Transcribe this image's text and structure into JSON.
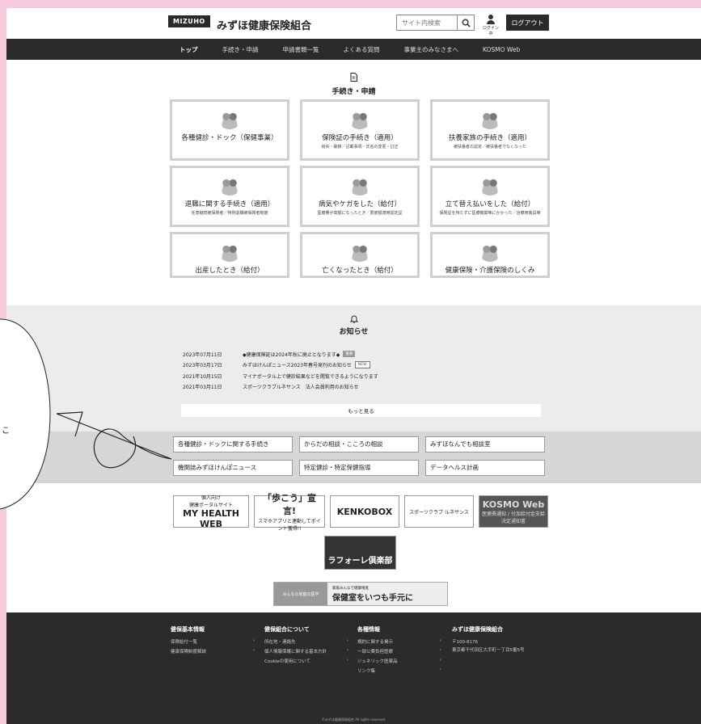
{
  "header": {
    "logo": "MIZUHO",
    "org_name": "みずほ健康保険組合",
    "search_placeholder": "サイト内検索",
    "login_status": "ログイン中",
    "logout_label": "ログアウト"
  },
  "nav": [
    "トップ",
    "手続き・申請",
    "申請書類一覧",
    "よくある質問",
    "事業主のみなさまへ",
    "KOSMO Web"
  ],
  "procedures": {
    "icon": "document-icon",
    "title": "手続き・申請",
    "cards": [
      {
        "title": "各種健診・ドック（保健事業）",
        "sub": ""
      },
      {
        "title": "保険証の手続き（適用）",
        "sub": "紛失・破損／記載事項・氏名の変更・訂正"
      },
      {
        "title": "扶養家族の手続き（適用）",
        "sub": "被扶養者の認定／被扶養者でなくなった"
      },
      {
        "title": "退職に関する手続き（適用）",
        "sub": "任意継続被保険者／特例退職被保険者制度"
      },
      {
        "title": "病気やケガをした（給付）",
        "sub": "医療費が高額になったとき／限度額適用認定証"
      },
      {
        "title": "立て替え払いをした（給付）",
        "sub": "保険証を持たずに医療機関等にかかった／治療用装具等"
      },
      {
        "title": "出産したとき（給付）",
        "sub": ""
      },
      {
        "title": "亡くなったとき（給付）",
        "sub": ""
      },
      {
        "title": "健康保険・介護保険のしくみ",
        "sub": ""
      }
    ]
  },
  "news": {
    "icon": "bell-icon",
    "title": "お知らせ",
    "items": [
      {
        "date": "2023年07月11日",
        "text": "◆健康保険証は2024年秋に廃止となります◆",
        "badge": "重要"
      },
      {
        "date": "2023年03月17日",
        "text": "みずほけんぽニュース2023年春号発刊のお知らせ",
        "badge": "NEW"
      },
      {
        "date": "2021年10月15日",
        "text": "マイナポータル上で健診結果などを閲覧できるようになります",
        "badge": ""
      },
      {
        "date": "2021年03月11日",
        "text": "スポーツクラブルネサンス　法人会員利用のお知らせ",
        "badge": ""
      }
    ],
    "more_label": "もっと見る"
  },
  "quick_links": [
    "各種健診・ドックに関する手続き",
    "からだの相談・こころの相談",
    "みずほなんでも相談室",
    "機関誌みずほけんぽニュース",
    "特定健診・特定保健指導",
    "データヘルス計画"
  ],
  "banners": {
    "myhealth_top": "個人向け",
    "myhealth_sub": "健康ポータルサイト",
    "myhealth_main": "MY HEALTH WEB",
    "arukou_main": "「歩こう」宣言!",
    "arukou_sub": "スマホアプリと連動してポイント獲得!!",
    "kenko": "KENKOBOX",
    "renaissance": "スポーツクラブ ルネサンス",
    "kosmo_main": "KOSMO Web",
    "kosmo_sub": "医療費通知 / 付加給付金支給決定通知書",
    "laforet": "ラフォーレ倶楽部",
    "minnano_left": "みんなの家庭の医学",
    "minnano_small": "家族みんなで健康増進",
    "minnano_main": "保健室をいつも手元に"
  },
  "footer": {
    "col1": {
      "title": "健保基本情報",
      "items": [
        "保険給付一覧",
        "健康保険制度解説"
      ]
    },
    "col2": {
      "title": "健保組合について",
      "items": [
        "所在地・連絡先",
        "個人情報保護に関する基本方針",
        "Cookieの使用について"
      ]
    },
    "col3": {
      "title": "各種情報",
      "items": [
        "規約に関する掲示",
        "一部公費負担医療",
        "ジェネリック医薬品",
        "リンク集"
      ]
    },
    "col4": {
      "title": "みずほ健康保険組合",
      "postal": "〒100-8176",
      "address": "東京都千代田区大手町一丁目5番5号"
    },
    "copyright": "©みずほ健康保険組合 All rights reserved."
  },
  "overlay_text": "こ"
}
